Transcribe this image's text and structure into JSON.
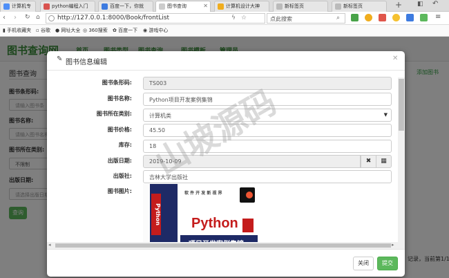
{
  "browser": {
    "tabs": [
      {
        "label": "计算机专"
      },
      {
        "label": "python编程入门"
      },
      {
        "label": "百度一下，你就"
      },
      {
        "label": "图书查询"
      },
      {
        "label": "计算机设计大神"
      },
      {
        "label": "新标签页"
      },
      {
        "label": "新标签页"
      }
    ],
    "url": "http://127.0.0.1:8000/Book/frontList",
    "search_placeholder": "点此搜索",
    "bookmarks": [
      "手机收藏夹",
      "谷歌",
      "网址大全",
      "360搜索",
      "百度一下",
      "游戏中心"
    ]
  },
  "app": {
    "brand": "图书查询网",
    "nav": [
      "首页",
      "图书类型",
      "图书查询",
      "图书模板",
      "管理员"
    ],
    "sidebar_title": "图书查询",
    "add_link": "添加图书",
    "filters": [
      {
        "label": "图书条形码:",
        "placeholder": "请输入图书条"
      },
      {
        "label": "图书名称:",
        "placeholder": "请输入图书名称"
      },
      {
        "label": "图书所在类别:",
        "value": "不限制"
      },
      {
        "label": "出版日期:",
        "placeholder": "请选择出版日期"
      }
    ],
    "query_button": "查询",
    "footer_text": "记录，当前第1/1页"
  },
  "modal": {
    "title": "图书信息编辑",
    "fields": {
      "barcode": {
        "label": "图书条形码:",
        "value": "TS003"
      },
      "name": {
        "label": "图书名称:",
        "value": "Python项目开发案例集锦"
      },
      "category": {
        "label": "图书所在类别:",
        "value": "计算机类"
      },
      "price": {
        "label": "图书价格:",
        "value": "45.50"
      },
      "stock": {
        "label": "库存:",
        "value": "18"
      },
      "pub_date": {
        "label": "出版日期:",
        "value": "2019-10-09"
      },
      "publisher": {
        "label": "出版社:",
        "value": "吉林大学出版社"
      },
      "image": {
        "label": "图书图片:"
      }
    },
    "cover": {
      "top_text": "软 件 开 发 新 视 界",
      "title_text": "Python",
      "sub_text": "项目开发案例集锦",
      "spine_text": "Python"
    },
    "close_button": "关闭",
    "submit_button": "提交"
  },
  "watermark": "山坡源码",
  "colors": {
    "accent": "#5cb85c",
    "brand": "#3b8c3b",
    "link": "#2e9e3e"
  }
}
